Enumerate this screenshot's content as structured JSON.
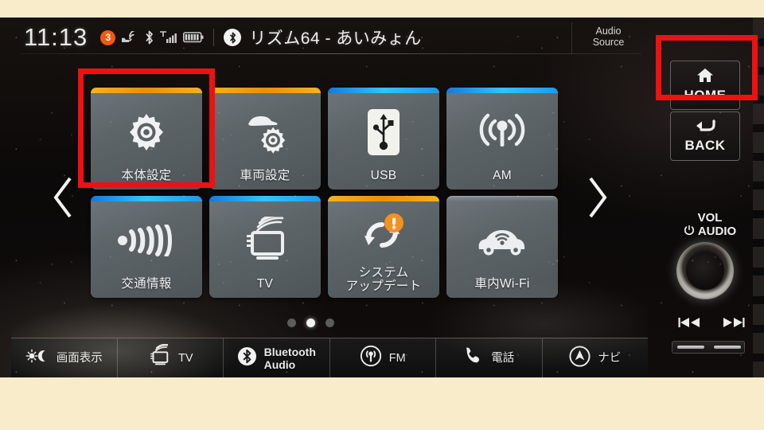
{
  "device": {
    "name": "car-infotainment-head-unit"
  },
  "statusbar": {
    "clock": "11:13",
    "notification_count": "3",
    "icons": [
      "car-wifi-icon",
      "bluetooth-icon",
      "signal-bars-icon",
      "battery-icon"
    ],
    "track_title": "リズム64 - あいみょん",
    "bluetooth_source_icon": "bluetooth-icon",
    "audio_source_line1": "Audio",
    "audio_source_line2": "Source"
  },
  "home": {
    "tiles": [
      {
        "label": "本体設定",
        "icon": "gear-icon",
        "accent": "#f0a713",
        "accent2": "#e08c05",
        "highlighted": true
      },
      {
        "label": "車両設定",
        "icon": "car-gear-icon",
        "accent": "#f0a713",
        "accent2": "#e08c05",
        "highlighted": false
      },
      {
        "label": "USB",
        "icon": "usb-icon",
        "accent": "#1f8ae0",
        "accent2": "#29c6f5",
        "highlighted": false
      },
      {
        "label": "AM",
        "icon": "broadcast-icon",
        "accent": "#1f8ae0",
        "accent2": "#29c6f5",
        "highlighted": false
      },
      {
        "label": "交通情報",
        "icon": "traffic-signal-icon",
        "accent": "#1f8ae0",
        "accent2": "#29c6f5",
        "highlighted": false
      },
      {
        "label": "TV",
        "icon": "tv-icon",
        "accent": "#1f8ae0",
        "accent2": "#29c6f5",
        "highlighted": false
      },
      {
        "label": "システム",
        "label2": "アップデート",
        "icon": "system-update-icon",
        "accent": "#f0a713",
        "accent2": "#e08c05",
        "badge": "!",
        "badge_color": "#f59120",
        "highlighted": false
      },
      {
        "label": "車内Wi-Fi",
        "icon": "car-wifi-icon",
        "accent": "none",
        "accent2": "none",
        "highlighted": false
      }
    ],
    "prev_page_icon": "chevron-left-icon",
    "next_page_icon": "chevron-right-icon",
    "page_dots": 3,
    "active_page": 2
  },
  "bottombar": {
    "items": [
      {
        "label": "画面表示",
        "icon": "brightness-day-night-icon"
      },
      {
        "label": "TV",
        "icon": "tv-icon"
      },
      {
        "label": "Bluetooth",
        "label2": "Audio",
        "icon": "bluetooth-icon",
        "bold": true
      },
      {
        "label": "FM",
        "icon": "broadcast-circle-icon"
      },
      {
        "label": "電話",
        "icon": "phone-icon"
      },
      {
        "label": "ナビ",
        "icon": "navigation-compass-icon"
      }
    ]
  },
  "hardware": {
    "home_button": {
      "label": "HOME",
      "icon": "house-icon",
      "highlighted": true
    },
    "back_button": {
      "label": "BACK",
      "icon": "back-arrow-icon"
    },
    "volume_knob": {
      "label_top": "VOL",
      "label_bottom": "AUDIO",
      "icon": "power-icon"
    },
    "seek_prev_icon": "skip-previous-icon",
    "seek_next_icon": "skip-next-icon"
  },
  "annotations": {
    "highlight_color": "#ee1111",
    "boxes": [
      "settings-tile-highlight",
      "home-button-highlight"
    ]
  }
}
